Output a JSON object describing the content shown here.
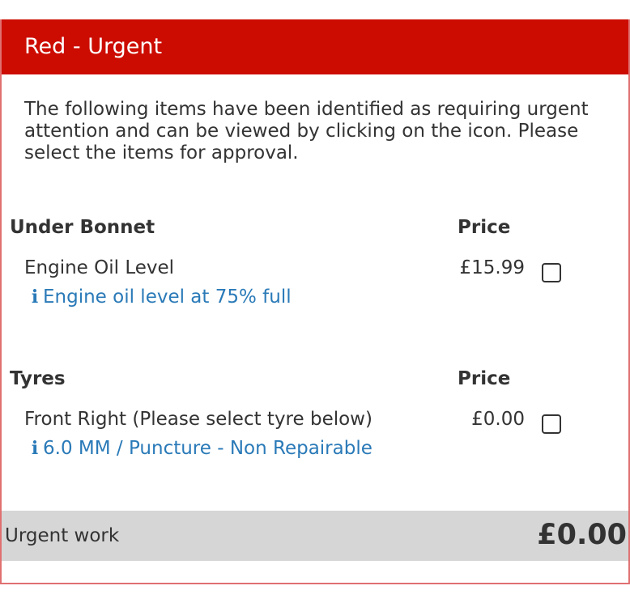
{
  "panel": {
    "title": "Red - Urgent",
    "intro": "The following items have been identified as requiring urgent attention and can be viewed by clicking on the icon. Please select the items for approval.",
    "header_color": "#cc0c00",
    "border_color": "#e07070",
    "info_color": "#2a7ab8"
  },
  "sections": [
    {
      "title": "Under Bonnet",
      "price_label": "Price",
      "items": [
        {
          "name": "Engine Oil Level",
          "price": "£15.99",
          "checked": false,
          "info_icon": "info-icon",
          "info": "Engine oil level at 75% full"
        }
      ]
    },
    {
      "title": "Tyres",
      "price_label": "Price",
      "items": [
        {
          "name": "Front Right (Please select tyre below)",
          "price": "£0.00",
          "checked": false,
          "info_icon": "info-icon",
          "info": "6.0 MM / Puncture - Non Repairable"
        }
      ]
    }
  ],
  "total": {
    "label": "Urgent work",
    "value": "£0.00"
  }
}
